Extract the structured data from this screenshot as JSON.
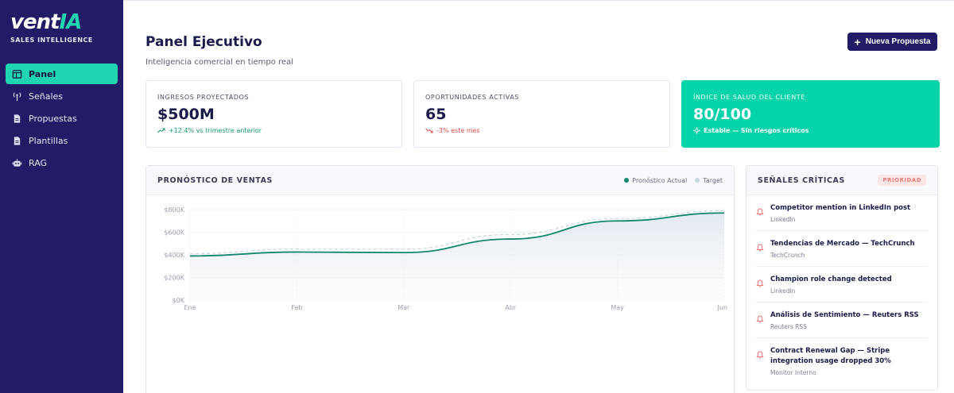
{
  "brand": {
    "logo_part1": "vent",
    "logo_part2": "IA",
    "tagline": "SALES INTELLIGENCE"
  },
  "sidebar": {
    "items": [
      {
        "label": "Panel",
        "icon": "layout-icon",
        "active": true
      },
      {
        "label": "Señales",
        "icon": "antenna-icon",
        "active": false
      },
      {
        "label": "Propuestas",
        "icon": "document-icon",
        "active": false
      },
      {
        "label": "Plantillas",
        "icon": "document-icon",
        "active": false
      },
      {
        "label": "RAG",
        "icon": "robot-icon",
        "active": false
      }
    ]
  },
  "header": {
    "title": "Panel Ejecutivo",
    "subtitle": "Inteligencia comercial en tiempo real",
    "new_proposal_label": "Nueva Propuesta"
  },
  "kpis": [
    {
      "label": "INGRESOS PROYECTADOS",
      "value": "$500M",
      "delta": "+12.4% vs trimestre anterior",
      "trend": "up"
    },
    {
      "label": "OPORTUNIDADES ACTIVAS",
      "value": "65",
      "delta": "-3% este mes",
      "trend": "down"
    },
    {
      "label": "ÍNDICE DE SALUD DEL CLIENTE",
      "value": "80/100",
      "delta": "Estable — Sin riesgos críticos",
      "trend": "stable"
    }
  ],
  "forecast": {
    "title": "PRONÓSTICO DE VENTAS",
    "legend_actual": "Pronóstico Actual",
    "legend_target": "Target"
  },
  "chart_data": {
    "type": "line",
    "categories": [
      "Ene",
      "Feb",
      "Mar",
      "Abr",
      "May",
      "Jun"
    ],
    "series": [
      {
        "name": "Pronóstico Actual",
        "values": [
          390,
          425,
          420,
          540,
          700,
          770
        ],
        "color": "#11866d"
      },
      {
        "name": "Target",
        "values": [
          410,
          450,
          450,
          580,
          720,
          790
        ],
        "color": "#c9d6dd"
      }
    ],
    "y_ticks": [
      "$0K",
      "$200K",
      "$400K",
      "$600K",
      "$800K"
    ],
    "y_tick_values": [
      0,
      200,
      400,
      600,
      800
    ],
    "ylim": [
      0,
      800
    ],
    "grid": true,
    "legend": "top-right"
  },
  "signals": {
    "title": "SEÑALES CRÍTICAS",
    "badge": "PRIORIDAD",
    "items": [
      {
        "title": "Competitor mention in LinkedIn post",
        "source": "LinkedIn"
      },
      {
        "title": "Tendencias de Mercado — TechCrunch",
        "source": "TechCrunch"
      },
      {
        "title": "Champion role change detected",
        "source": "LinkedIn"
      },
      {
        "title": "Análisis de Sentimiento — Reuters RSS",
        "source": "Reuters RSS"
      },
      {
        "title": "Contract Renewal Gap — Stripe integration usage dropped 30%",
        "source": "Monitor Interno"
      }
    ]
  },
  "colors": {
    "sidebar_bg": "#221c66",
    "accent": "#05d3a9",
    "primary_button": "#221c66",
    "chart_line": "#11866d",
    "negative": "#e04b4b",
    "positive": "#159e6a"
  }
}
